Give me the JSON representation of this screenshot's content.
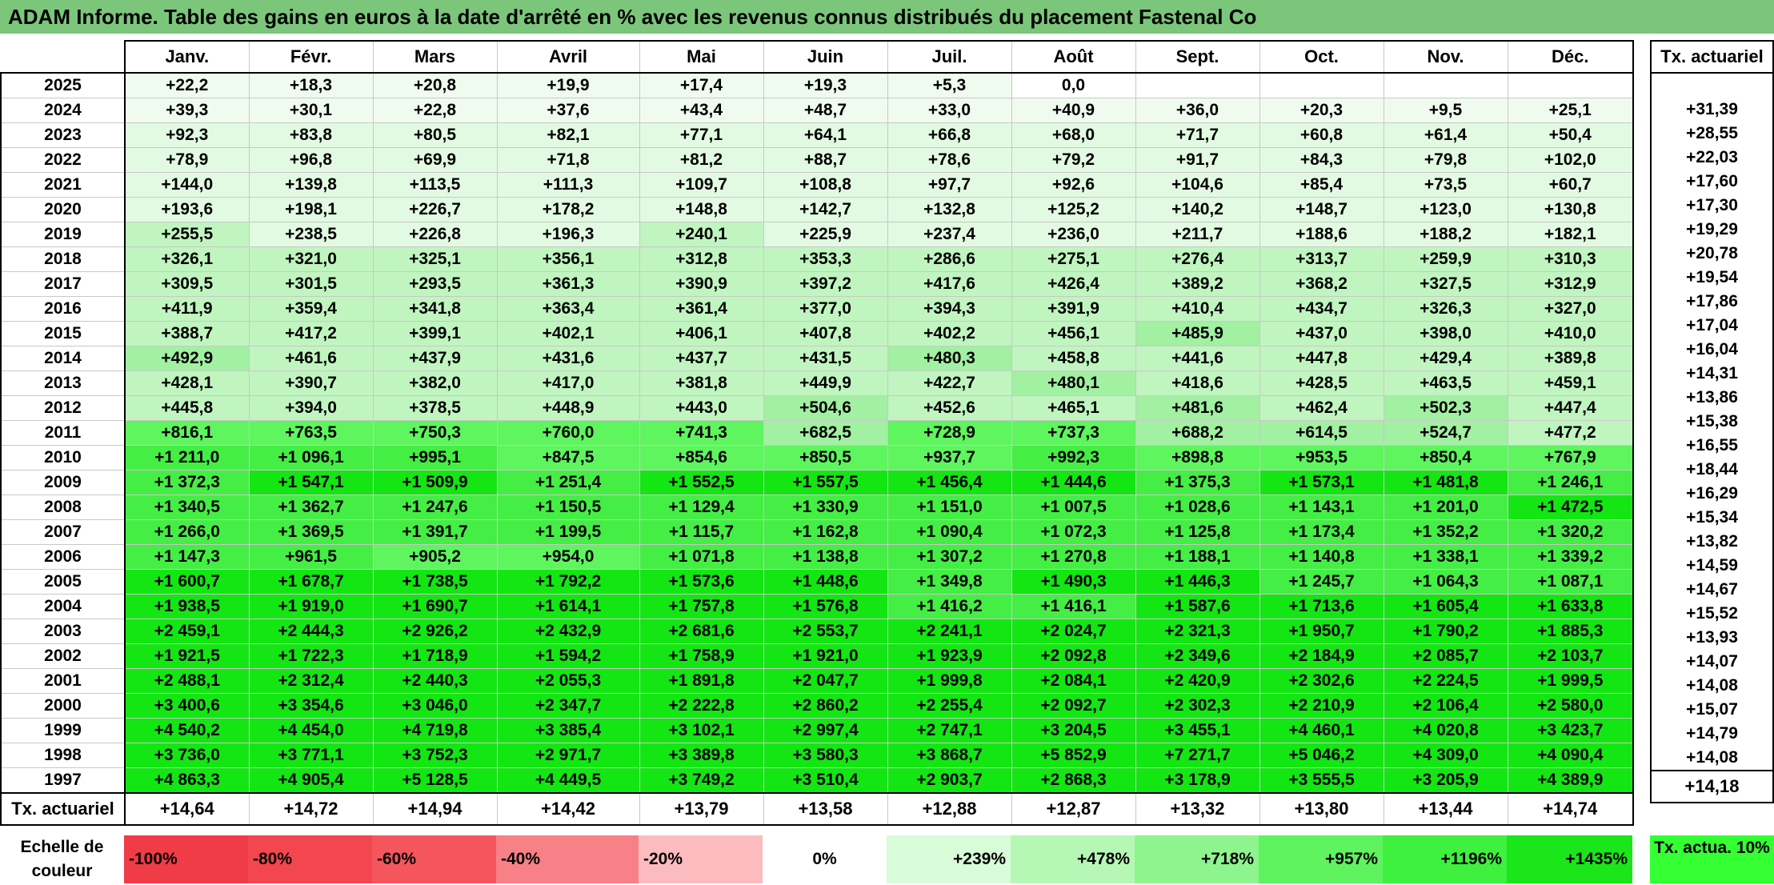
{
  "title": "ADAM Informe. Table des gains en euros à la date d'arrêté en % avec les revenus connus distribués du placement Fastenal Co",
  "months": [
    "Janv.",
    "Févr.",
    "Mars",
    "Avril",
    "Mai",
    "Juin",
    "Juil.",
    "Août",
    "Sept.",
    "Oct.",
    "Nov.",
    "Déc."
  ],
  "side_header": "Tx. actuariel",
  "rows": [
    {
      "year": "2025",
      "vals": [
        "+22,2",
        "+18,3",
        "+20,8",
        "+19,9",
        "+17,4",
        "+19,3",
        "+5,3",
        "0,0",
        "",
        "",
        "",
        ""
      ],
      "tx": ""
    },
    {
      "year": "2024",
      "vals": [
        "+39,3",
        "+30,1",
        "+22,8",
        "+37,6",
        "+43,4",
        "+48,7",
        "+33,0",
        "+40,9",
        "+36,0",
        "+20,3",
        "+9,5",
        "+25,1"
      ],
      "tx": "+31,39"
    },
    {
      "year": "2023",
      "vals": [
        "+92,3",
        "+83,8",
        "+80,5",
        "+82,1",
        "+77,1",
        "+64,1",
        "+66,8",
        "+68,0",
        "+71,7",
        "+60,8",
        "+61,4",
        "+50,4"
      ],
      "tx": "+28,55"
    },
    {
      "year": "2022",
      "vals": [
        "+78,9",
        "+96,8",
        "+69,9",
        "+71,8",
        "+81,2",
        "+88,7",
        "+78,6",
        "+79,2",
        "+91,7",
        "+84,3",
        "+79,8",
        "+102,0"
      ],
      "tx": "+22,03"
    },
    {
      "year": "2021",
      "vals": [
        "+144,0",
        "+139,8",
        "+113,5",
        "+111,3",
        "+109,7",
        "+108,8",
        "+97,7",
        "+92,6",
        "+104,6",
        "+85,4",
        "+73,5",
        "+60,7"
      ],
      "tx": "+17,60"
    },
    {
      "year": "2020",
      "vals": [
        "+193,6",
        "+198,1",
        "+226,7",
        "+178,2",
        "+148,8",
        "+142,7",
        "+132,8",
        "+125,2",
        "+140,2",
        "+148,7",
        "+123,0",
        "+130,8"
      ],
      "tx": "+17,30"
    },
    {
      "year": "2019",
      "vals": [
        "+255,5",
        "+238,5",
        "+226,8",
        "+196,3",
        "+240,1",
        "+225,9",
        "+237,4",
        "+236,0",
        "+211,7",
        "+188,6",
        "+188,2",
        "+182,1"
      ],
      "tx": "+19,29"
    },
    {
      "year": "2018",
      "vals": [
        "+326,1",
        "+321,0",
        "+325,1",
        "+356,1",
        "+312,8",
        "+353,3",
        "+286,6",
        "+275,1",
        "+276,4",
        "+313,7",
        "+259,9",
        "+310,3"
      ],
      "tx": "+20,78"
    },
    {
      "year": "2017",
      "vals": [
        "+309,5",
        "+301,5",
        "+293,5",
        "+361,3",
        "+390,9",
        "+397,2",
        "+417,6",
        "+426,4",
        "+389,2",
        "+368,2",
        "+327,5",
        "+312,9"
      ],
      "tx": "+19,54"
    },
    {
      "year": "2016",
      "vals": [
        "+411,9",
        "+359,4",
        "+341,8",
        "+363,4",
        "+361,4",
        "+377,0",
        "+394,3",
        "+391,9",
        "+410,4",
        "+434,7",
        "+326,3",
        "+327,0"
      ],
      "tx": "+17,86"
    },
    {
      "year": "2015",
      "vals": [
        "+388,7",
        "+417,2",
        "+399,1",
        "+402,1",
        "+406,1",
        "+407,8",
        "+402,2",
        "+456,1",
        "+485,9",
        "+437,0",
        "+398,0",
        "+410,0"
      ],
      "tx": "+17,04"
    },
    {
      "year": "2014",
      "vals": [
        "+492,9",
        "+461,6",
        "+437,9",
        "+431,6",
        "+437,7",
        "+431,5",
        "+480,3",
        "+458,8",
        "+441,6",
        "+447,8",
        "+429,4",
        "+389,8"
      ],
      "tx": "+16,04"
    },
    {
      "year": "2013",
      "vals": [
        "+428,1",
        "+390,7",
        "+382,0",
        "+417,0",
        "+381,8",
        "+449,9",
        "+422,7",
        "+480,1",
        "+418,6",
        "+428,5",
        "+463,5",
        "+459,1"
      ],
      "tx": "+14,31"
    },
    {
      "year": "2012",
      "vals": [
        "+445,8",
        "+394,0",
        "+378,5",
        "+448,9",
        "+443,0",
        "+504,6",
        "+452,6",
        "+465,1",
        "+481,6",
        "+462,4",
        "+502,3",
        "+447,4"
      ],
      "tx": "+13,86"
    },
    {
      "year": "2011",
      "vals": [
        "+816,1",
        "+763,5",
        "+750,3",
        "+760,0",
        "+741,3",
        "+682,5",
        "+728,9",
        "+737,3",
        "+688,2",
        "+614,5",
        "+524,7",
        "+477,2"
      ],
      "tx": "+15,38"
    },
    {
      "year": "2010",
      "vals": [
        "+1 211,0",
        "+1 096,1",
        "+995,1",
        "+847,5",
        "+854,6",
        "+850,5",
        "+937,7",
        "+992,3",
        "+898,8",
        "+953,5",
        "+850,4",
        "+767,9"
      ],
      "tx": "+16,55"
    },
    {
      "year": "2009",
      "vals": [
        "+1 372,3",
        "+1 547,1",
        "+1 509,9",
        "+1 251,4",
        "+1 552,5",
        "+1 557,5",
        "+1 456,4",
        "+1 444,6",
        "+1 375,3",
        "+1 573,1",
        "+1 481,8",
        "+1 246,1"
      ],
      "tx": "+18,44"
    },
    {
      "year": "2008",
      "vals": [
        "+1 340,5",
        "+1 362,7",
        "+1 247,6",
        "+1 150,5",
        "+1 129,4",
        "+1 330,9",
        "+1 151,0",
        "+1 007,5",
        "+1 028,6",
        "+1 143,1",
        "+1 201,0",
        "+1 472,5"
      ],
      "tx": "+16,29"
    },
    {
      "year": "2007",
      "vals": [
        "+1 266,0",
        "+1 369,5",
        "+1 391,7",
        "+1 199,5",
        "+1 115,7",
        "+1 162,8",
        "+1 090,4",
        "+1 072,3",
        "+1 125,8",
        "+1 173,4",
        "+1 352,2",
        "+1 320,2"
      ],
      "tx": "+15,34"
    },
    {
      "year": "2006",
      "vals": [
        "+1 147,3",
        "+961,5",
        "+905,2",
        "+954,0",
        "+1 071,8",
        "+1 138,8",
        "+1 307,2",
        "+1 270,8",
        "+1 188,1",
        "+1 140,8",
        "+1 338,1",
        "+1 339,2"
      ],
      "tx": "+13,82"
    },
    {
      "year": "2005",
      "vals": [
        "+1 600,7",
        "+1 678,7",
        "+1 738,5",
        "+1 792,2",
        "+1 573,6",
        "+1 448,6",
        "+1 349,8",
        "+1 490,3",
        "+1 446,3",
        "+1 245,7",
        "+1 064,3",
        "+1 087,1"
      ],
      "tx": "+14,59"
    },
    {
      "year": "2004",
      "vals": [
        "+1 938,5",
        "+1 919,0",
        "+1 690,7",
        "+1 614,1",
        "+1 757,8",
        "+1 576,8",
        "+1 416,2",
        "+1 416,1",
        "+1 587,6",
        "+1 713,6",
        "+1 605,4",
        "+1 633,8"
      ],
      "tx": "+14,67"
    },
    {
      "year": "2003",
      "vals": [
        "+2 459,1",
        "+2 444,3",
        "+2 926,2",
        "+2 432,9",
        "+2 681,6",
        "+2 553,7",
        "+2 241,1",
        "+2 024,7",
        "+2 321,3",
        "+1 950,7",
        "+1 790,2",
        "+1 885,3"
      ],
      "tx": "+15,52"
    },
    {
      "year": "2002",
      "vals": [
        "+1 921,5",
        "+1 722,3",
        "+1 718,9",
        "+1 594,2",
        "+1 758,9",
        "+1 921,0",
        "+1 923,9",
        "+2 092,8",
        "+2 349,6",
        "+2 184,9",
        "+2 085,7",
        "+2 103,7"
      ],
      "tx": "+13,93"
    },
    {
      "year": "2001",
      "vals": [
        "+2 488,1",
        "+2 312,4",
        "+2 440,3",
        "+2 055,3",
        "+1 891,8",
        "+2 047,7",
        "+1 999,8",
        "+2 084,1",
        "+2 420,9",
        "+2 302,6",
        "+2 224,5",
        "+1 999,5"
      ],
      "tx": "+14,07"
    },
    {
      "year": "2000",
      "vals": [
        "+3 400,6",
        "+3 354,6",
        "+3 046,0",
        "+2 347,7",
        "+2 222,8",
        "+2 860,2",
        "+2 255,4",
        "+2 092,7",
        "+2 302,3",
        "+2 210,9",
        "+2 106,4",
        "+2 580,0"
      ],
      "tx": "+14,08"
    },
    {
      "year": "1999",
      "vals": [
        "+4 540,2",
        "+4 454,0",
        "+4 719,8",
        "+3 385,4",
        "+3 102,1",
        "+2 997,4",
        "+2 747,1",
        "+3 204,5",
        "+3 455,1",
        "+4 460,1",
        "+4 020,8",
        "+3 423,7"
      ],
      "tx": "+15,07"
    },
    {
      "year": "1998",
      "vals": [
        "+3 736,0",
        "+3 771,1",
        "+3 752,3",
        "+2 971,7",
        "+3 389,8",
        "+3 580,3",
        "+3 868,7",
        "+5 852,9",
        "+7 271,7",
        "+5 046,2",
        "+4 309,0",
        "+4 090,4"
      ],
      "tx": "+14,79"
    },
    {
      "year": "1997",
      "vals": [
        "+4 863,3",
        "+4 905,4",
        "+5 128,5",
        "+4 449,5",
        "+3 749,2",
        "+3 510,4",
        "+2 903,7",
        "+2 868,3",
        "+3 178,9",
        "+3 555,5",
        "+3 205,9",
        "+4 389,9"
      ],
      "tx": "+14,08"
    }
  ],
  "footer": {
    "label": "Tx. actuariel",
    "vals": [
      "+14,64",
      "+14,72",
      "+14,94",
      "+14,42",
      "+13,79",
      "+13,58",
      "+12,88",
      "+12,87",
      "+13,32",
      "+13,80",
      "+13,44",
      "+14,74"
    ],
    "tx": "+14,18"
  },
  "scale": {
    "label": "Echelle de couleur",
    "items": [
      {
        "label": "-100%",
        "color": "#f03c46",
        "kind": "neg"
      },
      {
        "label": "-80%",
        "color": "#f3464f",
        "kind": "neg"
      },
      {
        "label": "-60%",
        "color": "#f5565d",
        "kind": "neg"
      },
      {
        "label": "-40%",
        "color": "#f88087",
        "kind": "neg"
      },
      {
        "label": "-20%",
        "color": "#fcbcbf",
        "kind": "neg"
      },
      {
        "label": "0%",
        "color": "#ffffff",
        "kind": "zero"
      },
      {
        "label": "+239%",
        "color": "#d8fbd8",
        "kind": "pos"
      },
      {
        "label": "+478%",
        "color": "#b6f7b6",
        "kind": "pos"
      },
      {
        "label": "+718%",
        "color": "#8ef58e",
        "kind": "pos"
      },
      {
        "label": "+957%",
        "color": "#5ff35f",
        "kind": "pos"
      },
      {
        "label": "+1196%",
        "color": "#3ff03f",
        "kind": "pos"
      },
      {
        "label": "+1435%",
        "color": "#1ae61a",
        "kind": "pos"
      }
    ],
    "tx_label": "Tx. actua. 10%",
    "tx_color": "#33ff33"
  }
}
